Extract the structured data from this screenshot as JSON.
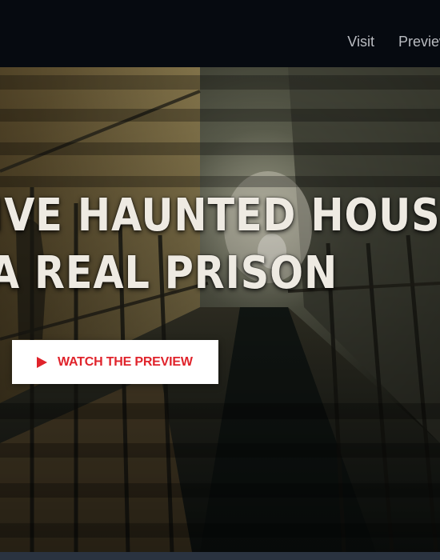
{
  "nav": {
    "items": [
      {
        "label": "Visit"
      },
      {
        "label": "Preview"
      }
    ]
  },
  "hero": {
    "headline_line1": "IVE HAUNTED HOUS",
    "headline_line2": "A REAL PRISON",
    "cta_label": "WATCH THE PREVIEW",
    "cta_icon": "play-icon"
  },
  "colors": {
    "topbar": "#060a10",
    "cta_text": "#e0232b",
    "cta_background": "#ffffff",
    "headline": "#eeeae2"
  }
}
